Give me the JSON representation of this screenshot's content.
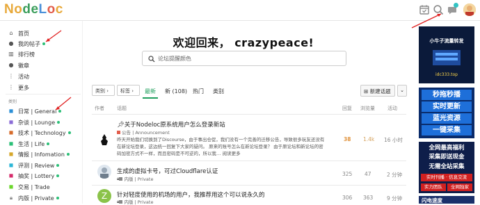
{
  "header": {
    "logo_letters": [
      "N",
      "o",
      "d",
      "e",
      "L",
      "o",
      "c"
    ],
    "logo_colors": [
      "#e8a93a",
      "#e8a93a",
      "#3b9e5b",
      "#3b9e5b",
      "#4a90d9",
      "#e25c4b",
      "#e8a93a"
    ],
    "icons": [
      "calendar-icon",
      "search-icon",
      "chat-icon",
      "user-avatar"
    ]
  },
  "sidebar": {
    "items": [
      {
        "label": "首页",
        "icon": "home-icon"
      },
      {
        "label": "我的帖子",
        "icon": "user-icon",
        "dot": true
      },
      {
        "label": "排行榜",
        "icon": "chart-icon"
      },
      {
        "label": "徽章",
        "icon": "badge-icon"
      },
      {
        "label": "活动",
        "icon": "activity-icon"
      },
      {
        "label": "更多",
        "icon": "more-icon"
      }
    ],
    "section_label": "类别",
    "categories": [
      {
        "label": "日常 | General",
        "dot": true,
        "color": "#2b8fd6"
      },
      {
        "label": "杂谈 | Lounge",
        "dot": true,
        "color": "#8a6bd6"
      },
      {
        "label": "技术 | Technology",
        "dot": true,
        "color": "#d66b2b"
      },
      {
        "label": "生活 | Life",
        "dot": true,
        "color": "#2bbf77"
      },
      {
        "label": "情报 | Infomation",
        "dot": true,
        "color": "#d6a72b"
      },
      {
        "label": "评测 | Review",
        "dot": true,
        "color": "#2bb6d6"
      },
      {
        "label": "抽奖 | Lottery",
        "dot": true,
        "color": "#d62b6b"
      },
      {
        "label": "交易 | Trade",
        "dot": false,
        "color": "#6bd62b"
      },
      {
        "label": "内版 | Private",
        "dot": true,
        "color": "#888888"
      }
    ]
  },
  "main": {
    "welcome": "欢迎回来， crazypeace!",
    "search_placeholder": "论坛提醒颜色",
    "filters": {
      "category": "类别",
      "tags": "标签",
      "tabs": [
        "最新",
        "新 (108)",
        "热门",
        "类别"
      ],
      "active_tab": "最新",
      "new_topic": "新建话题"
    },
    "columns": {
      "author": "作者",
      "topic": "话题",
      "replies": "回复",
      "views": "浏览量",
      "activity": "活动"
    },
    "topics": [
      {
        "title": "关于Nodeloc原系统用户怎么登录新站",
        "category": "公告 | Announcement",
        "cat_color": "#e25c4b",
        "excerpt": "昨天开始我们切换到了Discourse，由于事出仓促，我们没有一个完善的迁移公告，导致很多玩友还没有在新论坛登录，这边统一回复下大家的疑问。 原来的账号怎么在新论坛登录？ 由于原论坛和新论坛的密码加密方式不一样，而且密码是不可逆的，所以我… 阅读更多",
        "replies": "38",
        "views": "1.4k",
        "activity": "16 小时",
        "pinned": true
      },
      {
        "title": "生成的虚拟卡号，可过Cloudflare认证",
        "category": "内版 | Private",
        "cat_color": "#888888",
        "excerpt": "",
        "replies": "325",
        "views": "47",
        "activity": "2 分钟"
      },
      {
        "title": "针对轻度使用的机场的用户，我推荐用这个可以说永久的",
        "category": "内版 | Private",
        "cat_color": "#888888",
        "excerpt": "",
        "replies": "306",
        "views": "363",
        "activity": "9 分钟",
        "avatar_letter": "Z"
      }
    ]
  },
  "ads": {
    "ad1_lines": [
      "小牛子流量转发",
      "idc333.top"
    ],
    "ad2_lines": [
      "秒拖秒播",
      "实时更新",
      "蓝光资源",
      "一键采集"
    ],
    "ad3_lines": [
      "全网最高福利",
      "采集即送现金",
      "无需全站采集",
      "实力团队",
      "全网独家"
    ],
    "ad4_lines": [
      "闪电速度"
    ]
  }
}
